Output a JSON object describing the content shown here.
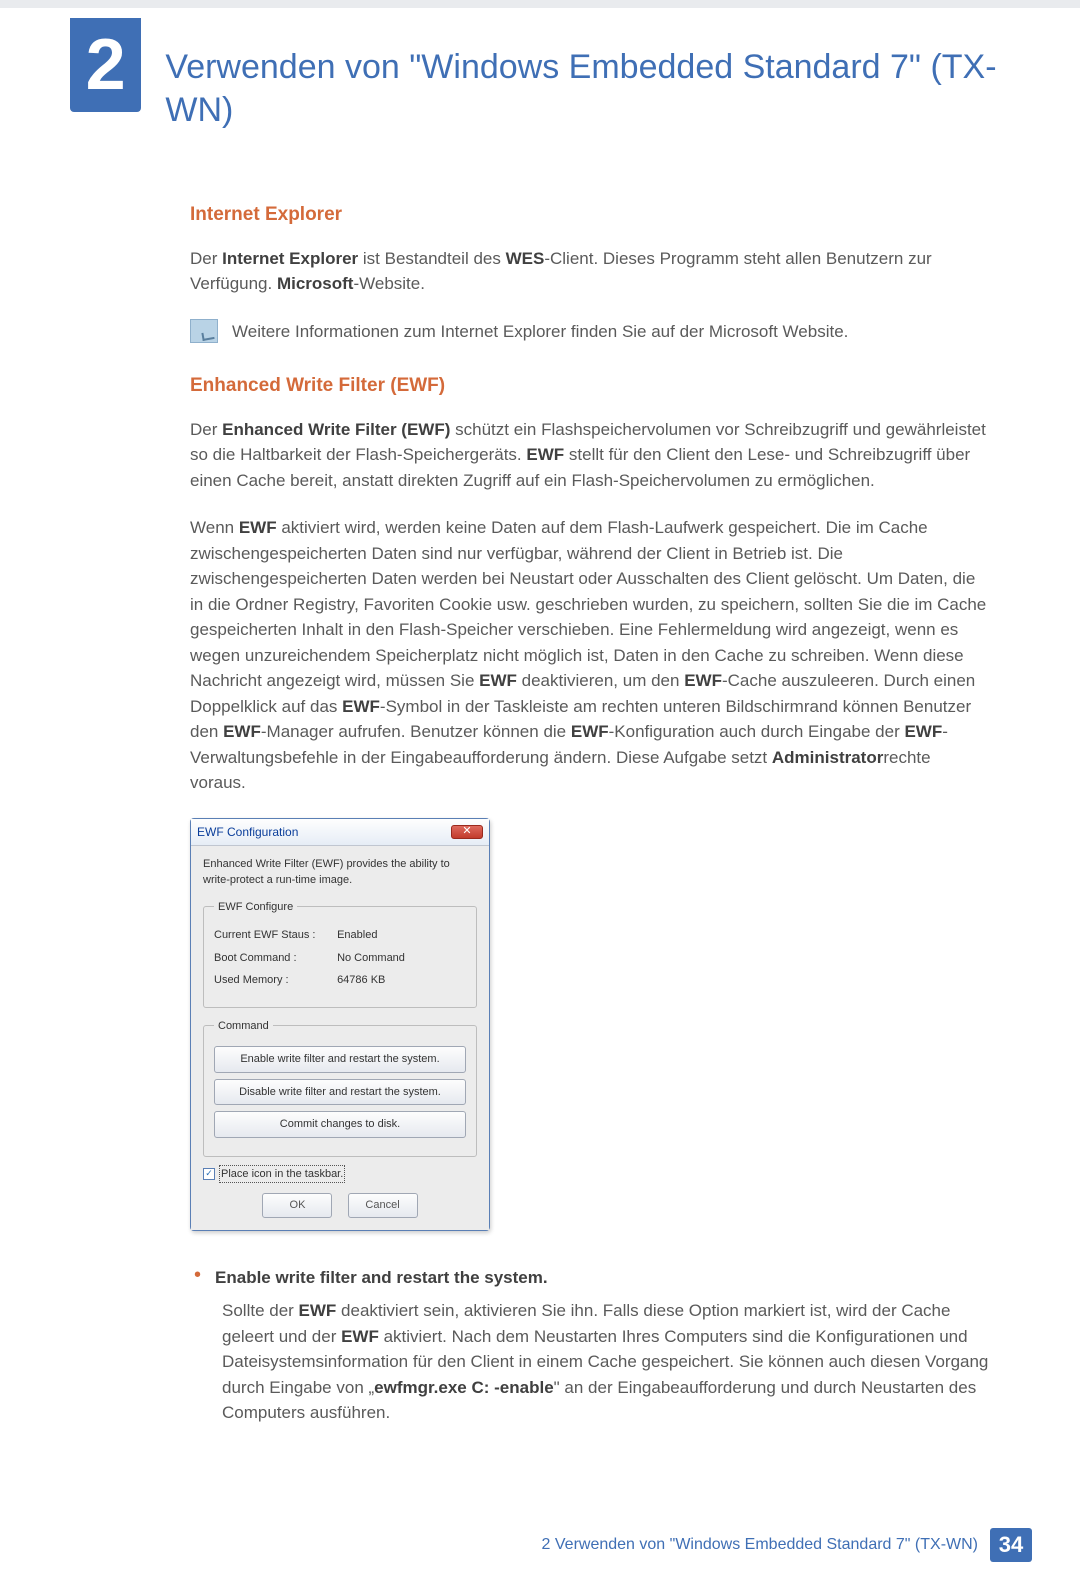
{
  "chapter": {
    "number": "2",
    "title": "Verwenden von \"Windows Embedded Standard 7\" (TX-WN)"
  },
  "ie": {
    "heading": "Internet Explorer",
    "para": "Der Internet Explorer ist Bestandteil des WES-Client. Dieses Programm steht allen Benutzern zur Verfügung. Microsoft-Website.",
    "note": "Weitere Informationen zum Internet Explorer finden Sie auf der Microsoft Website."
  },
  "ewf": {
    "heading": "Enhanced Write Filter (EWF)",
    "para1": "Der Enhanced Write Filter (EWF) schützt ein Flashspeichervolumen vor Schreibzugriff und gewährleistet so die Haltbarkeit der Flash-Speichergeräts. EWF stellt für den Client den Lese- und Schreibzugriff über einen Cache bereit, anstatt direkten Zugriff auf ein Flash-Speichervolumen zu ermöglichen.",
    "para2": "Wenn EWF aktiviert wird, werden keine Daten auf dem Flash-Laufwerk gespeichert. Die im Cache zwischengespeicherten Daten sind nur verfügbar, während der Client in Betrieb ist. Die zwischengespeicherten Daten werden bei Neustart oder Ausschalten des Client gelöscht. Um Daten, die in die Ordner Registry, Favoriten Cookie usw. geschrieben wurden, zu speichern, sollten Sie die im Cache gespeicherten Inhalt in den Flash-Speicher verschieben. Eine Fehlermeldung wird angezeigt, wenn es wegen unzureichendem Speicherplatz nicht möglich ist, Daten in den Cache zu schreiben. Wenn diese Nachricht angezeigt wird, müssen Sie EWF deaktivieren, um den EWF-Cache auszuleeren. Durch einen Doppelklick auf das EWF-Symbol in der Taskleiste am rechten unteren Bildschirmrand können Benutzer den EWF-Manager aufrufen. Benutzer können die EWF-Konfiguration auch durch Eingabe der EWF-Verwaltungsbefehle in der Eingabeaufforderung ändern. Diese Aufgabe setzt Administratorrechte voraus."
  },
  "dialog": {
    "title": "EWF Configuration",
    "desc": "Enhanced Write Filter (EWF) provides the ability to write-protect a run-time image.",
    "group1": "EWF Configure",
    "status_label": "Current EWF Staus :",
    "status_value": "Enabled",
    "boot_label": "Boot Command :",
    "boot_value": "No Command",
    "mem_label": "Used Memory :",
    "mem_value": "64786 KB",
    "group2": "Command",
    "btn_enable": "Enable write filter and restart the system.",
    "btn_disable": "Disable write filter and restart the system.",
    "btn_commit": "Commit changes to disk.",
    "chk_taskbar": "Place icon in the taskbar.",
    "ok": "OK",
    "cancel": "Cancel"
  },
  "bullet": {
    "title": "Enable write filter and restart the system.",
    "body": "Sollte der EWF deaktiviert sein, aktivieren Sie ihn. Falls diese Option markiert ist, wird der Cache geleert und der EWF aktiviert. Nach dem Neustarten Ihres Computers sind die Konfigurationen und Dateisystemsinformation für den Client in einem Cache gespeichert. Sie können auch diesen Vorgang durch Eingabe von „ewfmgr.exe C: -enable\" an der Eingabeaufforderung und durch Neustarten des Computers ausführen."
  },
  "footer": {
    "text": "2 Verwenden von \"Windows Embedded Standard 7\" (TX-WN)",
    "page": "34"
  }
}
